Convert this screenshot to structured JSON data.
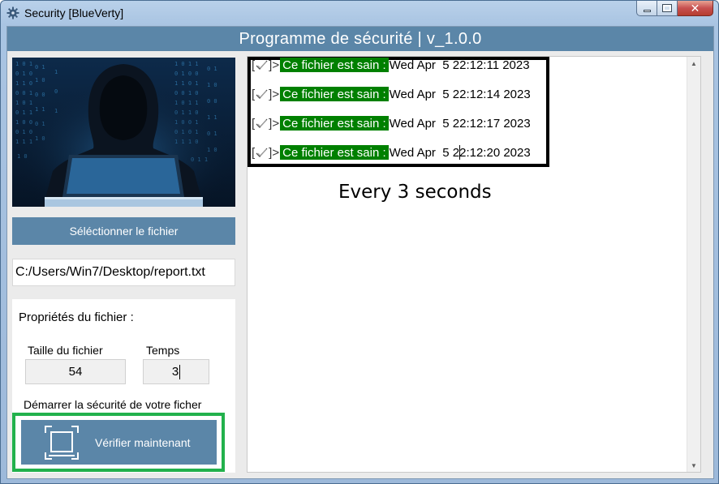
{
  "window": {
    "title": "Security [BlueVerty]",
    "icon": "gear-icon"
  },
  "header": {
    "title": "Programme de sécurité | v_1.0.0"
  },
  "left_panel": {
    "image": "hacker-image",
    "select_button_label": "Séléctionner le fichier",
    "file_path": "C:/Users/Win7/Desktop/report.txt",
    "properties_title": "Propriétés du fichier :",
    "size_label": "Taille du fichier",
    "size_value": "54",
    "time_label": "Temps",
    "time_value": "3",
    "start_label": "Démarrer la sécurité de votre ficher",
    "verify_button_label": "Vérifier maintenant",
    "verify_icon": "scan-icon"
  },
  "log": {
    "entries": [
      {
        "open": "[",
        "close": "]>",
        "status": "Ce fichier est sain :",
        "timestamp": "Wed Apr  5 22:12:11 2023"
      },
      {
        "open": "[",
        "close": "]>",
        "status": "Ce fichier est sain :",
        "timestamp": "Wed Apr  5 22:12:14 2023"
      },
      {
        "open": "[",
        "close": "]>",
        "status": "Ce fichier est sain :",
        "timestamp": "Wed Apr  5 22:12:17 2023"
      },
      {
        "open": "[",
        "close": "]>",
        "status": "Ce fichier est sain :",
        "timestamp": "Wed Apr  5 22:12:20 2023"
      }
    ],
    "annotation": "Every 3 seconds"
  },
  "colors": {
    "accent": "#5b86a8",
    "status_green": "#008000",
    "outline_green": "#22b14c",
    "outline_black": "#000000"
  }
}
